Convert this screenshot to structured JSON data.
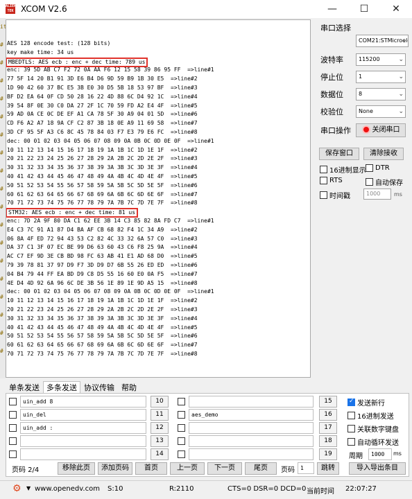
{
  "window": {
    "title": "XCOM V2.6",
    "icon_text": "ALIENTEK",
    "minimize": "—",
    "maximize": "☐",
    "close": "✕"
  },
  "left_strip": [
    "it",
    "#",
    "#",
    "#",
    "#",
    "#",
    "#",
    "#",
    "#",
    "#",
    "#",
    "#",
    "#",
    "#",
    "#",
    "#",
    "#",
    "#",
    "#"
  ],
  "receive": {
    "lines": [
      {
        "text": "AES 128 encode test: (128 bits)"
      },
      {
        "text": "key make time: 34 us"
      },
      {
        "text": "MBEDTLS: AES ecb : enc + dec time: 789 us",
        "highlight": true
      },
      {
        "text": "enc: 39 5D AB C7 F2 72 0A AA F6 12 15 58 39 86 95 FF  =>line#1"
      },
      {
        "text": "77 5F 14 20 B1 91 3D E6 B4 D6 9D 59 B9 1B 30 E5  =>line#2"
      },
      {
        "text": "1D 90 42 60 37 BC E5 3B E0 30 D5 5B 18 53 97 BF  =>line#3"
      },
      {
        "text": "BF D2 EA 64 0F CD 50 28 16 22 4D 88 6C D4 92 1C  =>line#4"
      },
      {
        "text": "39 54 8F 0E 30 C0 DA 27 2F 1C 70 59 FD A2 E4 4F  =>line#5"
      },
      {
        "text": "59 AD 0A CE 0C DE EF A1 CA 78 5F 30 A9 04 01 5D  =>line#6"
      },
      {
        "text": "CD F6 A2 A7 18 9A CF C2 87 3B 18 0E A9 11 69 58  =>line#7"
      },
      {
        "text": "3D CF 95 5F A3 C6 8C 45 78 84 03 F7 E3 79 E6 FC  =>line#8"
      },
      {
        "text": "dec: 00 01 02 03 04 05 06 07 08 09 0A 0B 0C 0D 0E 0F  =>line#1"
      },
      {
        "text": "10 11 12 13 14 15 16 17 18 19 1A 1B 1C 1D 1E 1F  =>line#2"
      },
      {
        "text": "20 21 22 23 24 25 26 27 28 29 2A 2B 2C 2D 2E 2F  =>line#3"
      },
      {
        "text": "30 31 32 33 34 35 36 37 38 39 3A 3B 3C 3D 3E 3F  =>line#4"
      },
      {
        "text": "40 41 42 43 44 45 46 47 48 49 4A 4B 4C 4D 4E 4F  =>line#5"
      },
      {
        "text": "50 51 52 53 54 55 56 57 58 59 5A 5B 5C 5D 5E 5F  =>line#6"
      },
      {
        "text": "60 61 62 63 64 65 66 67 68 69 6A 6B 6C 6D 6E 6F  =>line#7"
      },
      {
        "text": "70 71 72 73 74 75 76 77 78 79 7A 7B 7C 7D 7E 7F  =>line#8"
      },
      {
        "text": "STM32: AES ecb : enc + dec time: 81 us",
        "highlight": true
      },
      {
        "text": "enc: 7D 2A 9F 80 DA C1 62 EE 3B 14 C3 85 82 8A FD C7  =>line#1"
      },
      {
        "text": "E4 C3 7C 91 A1 87 D4 BA AF CB 68 82 F4 1C 34 A9  =>line#2"
      },
      {
        "text": "06 8A 4F ED 72 94 43 53 C2 82 4C 33 32 6A 57 C0  =>line#3"
      },
      {
        "text": "DA 37 C1 3F 07 EC BE 99 D6 63 60 43 C6 F8 25 9A  =>line#4"
      },
      {
        "text": "AC C7 EF 9D 3E CB BD 98 FC 63 AB 41 E1 AD 68 D0  =>line#5"
      },
      {
        "text": "79 39 78 81 37 97 D9 F7 3D D9 D7 6B 55 26 ED ED  =>line#6"
      },
      {
        "text": "04 B4 79 44 FF EA BD D9 C8 D5 55 16 60 E0 0A F5  =>line#7"
      },
      {
        "text": "4E D4 4D 92 6A 96 6C DE 3B 56 1E 89 1E 9D A5 15  =>line#8"
      },
      {
        "text": "dec: 00 01 02 03 04 05 06 07 08 09 0A 0B 0C 0D 0E 0F  =>line#1"
      },
      {
        "text": "10 11 12 13 14 15 16 17 18 19 1A 1B 1C 1D 1E 1F  =>line#2"
      },
      {
        "text": "20 21 22 23 24 25 26 27 28 29 2A 2B 2C 2D 2E 2F  =>line#3"
      },
      {
        "text": "30 31 32 33 34 35 36 37 38 39 3A 3B 3C 3D 3E 3F  =>line#4"
      },
      {
        "text": "40 41 42 43 44 45 46 47 48 49 4A 4B 4C 4D 4E 4F  =>line#5"
      },
      {
        "text": "50 51 52 53 54 55 56 57 58 59 5A 5B 5C 5D 5E 5F  =>line#6"
      },
      {
        "text": "60 61 62 63 64 65 66 67 68 69 6A 6B 6C 6D 6E 6F  =>line#7"
      },
      {
        "text": "70 71 72 73 74 75 76 77 78 79 7A 7B 7C 7D 7E 7F  =>line#8"
      }
    ]
  },
  "serial": {
    "section_title": "串口选择",
    "port": "COM21:STMicroelectror",
    "baud_label": "波特率",
    "baud": "115200",
    "stop_label": "停止位",
    "stop": "1",
    "data_label": "数据位",
    "data": "8",
    "parity_label": "校验位",
    "parity": "None",
    "op_label": "串口操作",
    "close_port": "关闭串口",
    "save_window": "保存窗口",
    "clear_recv": "清除接收",
    "hex_display": "16进制显示",
    "dtr": "DTR",
    "rts": "RTS",
    "auto_save": "自动保存",
    "timestamp": "时间戳",
    "timestamp_ms": "1000",
    "ms": "ms"
  },
  "tabs": [
    "单条发送",
    "多条发送",
    "协议传输",
    "帮助"
  ],
  "multi_send": {
    "left_rows": [
      {
        "text": "uin_add 8",
        "num": "10"
      },
      {
        "text": "uin_del",
        "num": "11"
      },
      {
        "text": "uin_add :",
        "num": "12"
      },
      {
        "text": "",
        "num": "13"
      },
      {
        "text": "",
        "num": "14"
      }
    ],
    "right_rows": [
      {
        "text": "",
        "num": "15"
      },
      {
        "text": "aes_demo",
        "num": "16"
      },
      {
        "text": "",
        "num": "17"
      },
      {
        "text": "",
        "num": "18"
      },
      {
        "text": "",
        "num": "19"
      }
    ],
    "send_newline": "发送新行",
    "hex_send": "16进制发送",
    "link_keyboard": "关联数字键盘",
    "auto_loop": "自动循环发送",
    "period_label": "周期",
    "period": "1000",
    "ms": "ms",
    "page_label": "页码 2/4",
    "remove_page": "移除此页",
    "add_page": "添加页码",
    "first_page": "首页",
    "prev_page": "上一页",
    "next_page": "下一页",
    "last_page": "尾页",
    "goto_label": "页码",
    "goto_value": "1",
    "jump": "跳转",
    "import_export": "导入导出条目"
  },
  "status": {
    "url": "www.openedv.com",
    "s": "S:10",
    "r": "R:2110",
    "lines": "CTS=0 DSR=0 DCD=0",
    "time_label": "当前时间",
    "time": "22:07:27"
  }
}
